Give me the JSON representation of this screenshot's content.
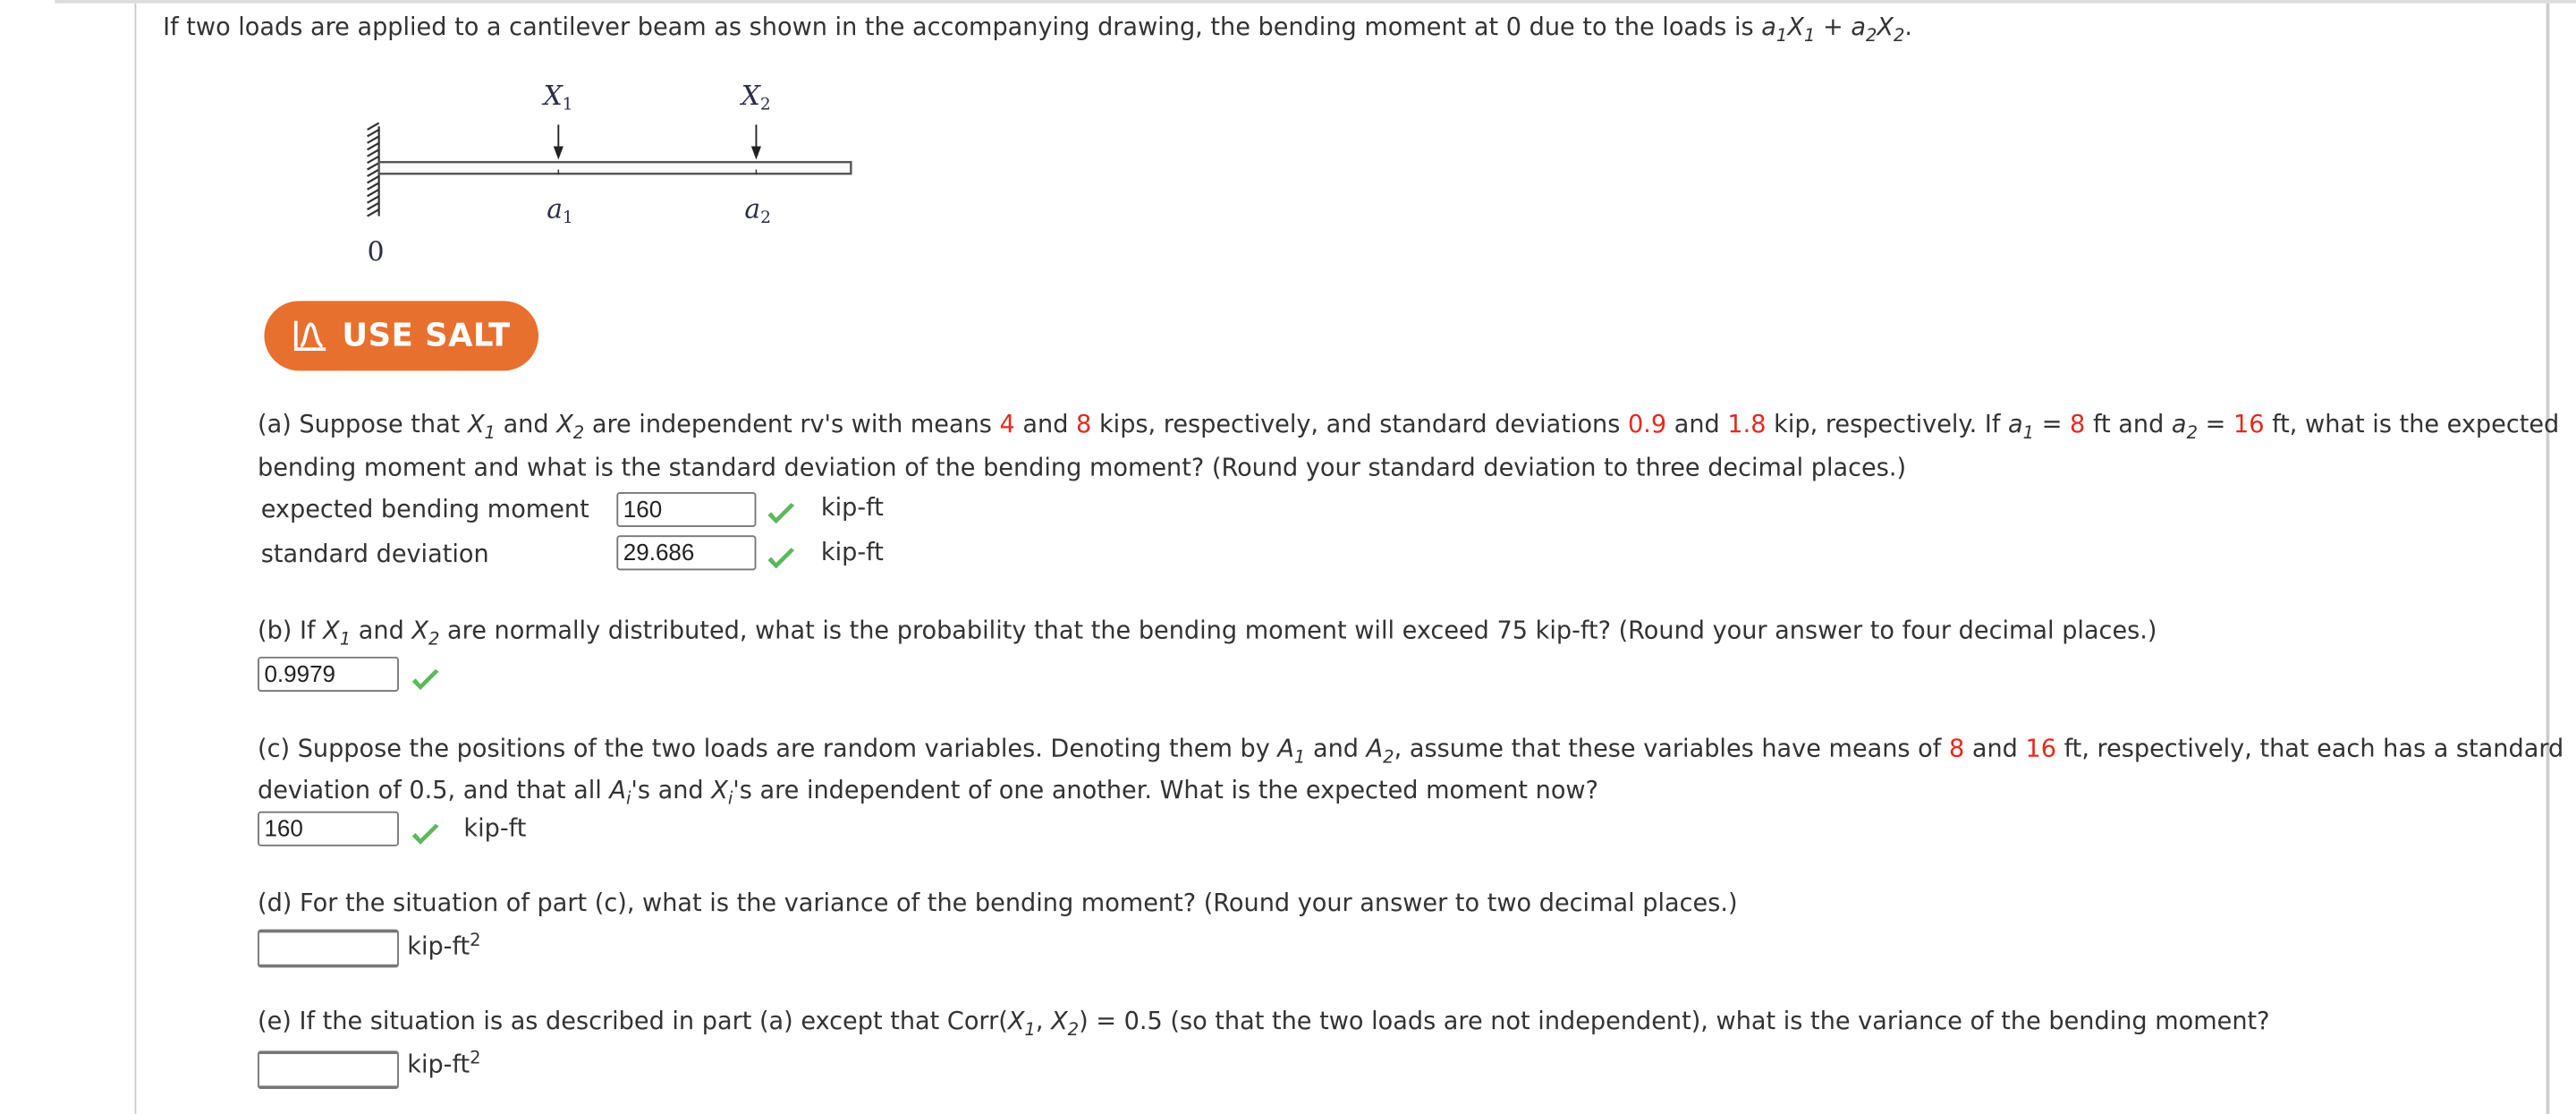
{
  "intro": {
    "text_before": "If two loads are applied to a cantilever beam as shown in the accompanying drawing, the bending moment at 0 due to the loads is ",
    "formula": {
      "a1": "a",
      "a1_sub": "1",
      "x1": "X",
      "x1_sub": "1",
      "plus": " + ",
      "a2": "a",
      "a2_sub": "2",
      "x2": "X",
      "x2_sub": "2",
      "end": "."
    }
  },
  "diagram": {
    "load1_label": "X",
    "load1_sub": "1",
    "load2_label": "X",
    "load2_sub": "2",
    "pos1_label": "a",
    "pos1_sub": "1",
    "pos2_label": "a",
    "pos2_sub": "2",
    "origin_label": "0"
  },
  "salt_button": {
    "label": "USE SALT",
    "icon": "distribution-curve-icon",
    "color": "#e8702e"
  },
  "highlight_color": "#e8281e",
  "check_color": "#5cb85c",
  "part_a": {
    "t1": "(a) Suppose that ",
    "x1": "X",
    "x1_sub": "1",
    "t2": " and ",
    "x2": "X",
    "x2_sub": "2",
    "t3": " are independent rv's with means ",
    "mean1": "4",
    "t4": " and ",
    "mean2": "8",
    "t5": " kips, respectively, and standard deviations ",
    "sd1": "0.9",
    "t6": " and ",
    "sd2": "1.8",
    "t7": " kip, respectively. If ",
    "a1": "a",
    "a1_sub": "1",
    "t8": " = ",
    "a1_val": "8",
    "t9": " ft and ",
    "a2": "a",
    "a2_sub": "2",
    "t10": " = ",
    "a2_val": "16",
    "t11": " ft, what is the expected",
    "line2": "bending moment and what is the standard deviation of the bending moment? (Round your standard deviation to three decimal places.)",
    "answers": [
      {
        "label": "expected bending moment",
        "value": "160",
        "unit": "kip-ft",
        "status": "correct"
      },
      {
        "label": "standard deviation",
        "value": "29.686",
        "unit": "kip-ft",
        "status": "correct"
      }
    ]
  },
  "part_b": {
    "t1": "(b) If ",
    "x1": "X",
    "x1_sub": "1",
    "t2": " and ",
    "x2": "X",
    "x2_sub": "2",
    "t3": " are normally distributed, what is the probability that the bending moment will exceed 75 kip-ft? (Round your answer to four decimal places.)",
    "answer": {
      "value": "0.9979",
      "status": "correct"
    }
  },
  "part_c": {
    "t1": "(c) Suppose the positions of the two loads are random variables. Denoting them by ",
    "A1": "A",
    "A1_sub": "1",
    "t2": " and ",
    "A2": "A",
    "A2_sub": "2",
    "t3": ", assume that these variables have means of ",
    "mean1": "8",
    "t4": " and ",
    "mean2": "16",
    "t5": " ft, respectively, that each has a standard",
    "l2_t1": "deviation of 0.5, and that all ",
    "Ai": "A",
    "Ai_sub": "i",
    "l2_t2": "'s and ",
    "Xi": "X",
    "Xi_sub": "i",
    "l2_t3": "'s are independent of one another. What is the expected moment now?",
    "answer": {
      "value": "160",
      "unit": "kip-ft",
      "status": "correct"
    }
  },
  "part_d": {
    "text": "(d) For the situation of part (c), what is the variance of the bending moment? (Round your answer to two decimal places.)",
    "answer": {
      "value": "",
      "unit": "kip-ft",
      "unit_sup": "2"
    }
  },
  "part_e": {
    "t1": "(e) If the situation is as described in part (a) except that Corr(",
    "x1": "X",
    "x1_sub": "1",
    "t2": ", ",
    "x2": "X",
    "x2_sub": "2",
    "t3": ") = 0.5 (so that the two loads are not independent), what is the variance of the bending moment?",
    "answer": {
      "value": "",
      "unit": "kip-ft",
      "unit_sup": "2"
    }
  }
}
